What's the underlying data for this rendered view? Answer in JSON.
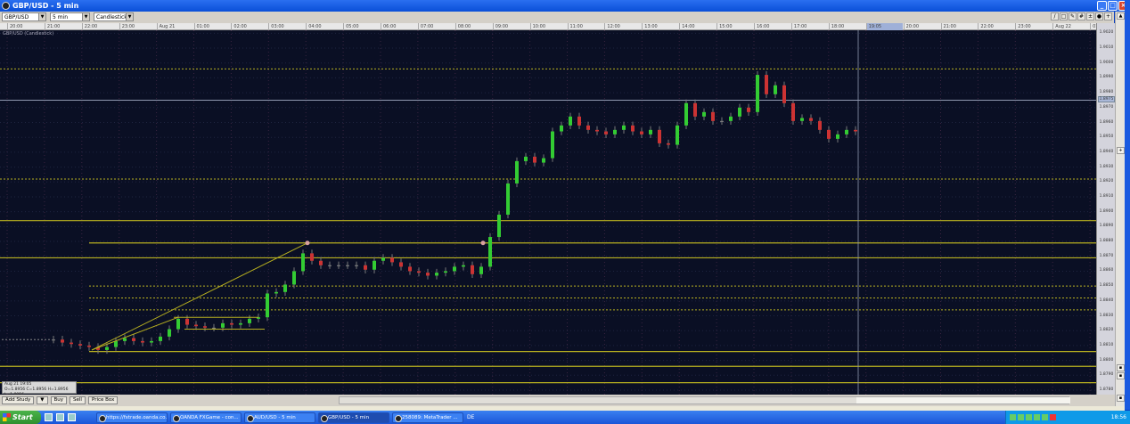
{
  "window": {
    "title": "GBP/USD - 5 min"
  },
  "toolbar": {
    "instrument": "GBP/USD",
    "interval": "5 min",
    "chart_type": "Candlestick"
  },
  "chart_label": "GBP/USD (Candlestick)",
  "time_axis": [
    "20:00",
    "21:00",
    "22:00",
    "23:00",
    "Aug 21",
    "01:00",
    "02:00",
    "03:00",
    "04:00",
    "05:00",
    "06:00",
    "07:00",
    "08:00",
    "09:00",
    "10:00",
    "11:00",
    "12:00",
    "13:00",
    "14:00",
    "15:00",
    "16:00",
    "17:00",
    "18:00",
    "19:05",
    "20:00",
    "21:00",
    "22:00",
    "23:00",
    "Aug 22",
    "01:00"
  ],
  "time_axis_highlight_index": 23,
  "price_axis": [
    "1.9020",
    "1.9010",
    "1.9000",
    "1.8990",
    "1.8980",
    "1.8970",
    "1.8960",
    "1.8950",
    "1.8940",
    "1.8930",
    "1.8920",
    "1.8910",
    "1.8900",
    "1.8890",
    "1.8880",
    "1.8870",
    "1.8860",
    "1.8850",
    "1.8840",
    "1.8830",
    "1.8820",
    "1.8810",
    "1.8800",
    "1.8790",
    "1.8780"
  ],
  "current_price": "1.8975",
  "info_box": {
    "date": "Aug 21 19:05",
    "ohlc": "O=1.8956 C=1.8956 H=1.8956 L=1.8956"
  },
  "bottom_bar": {
    "add_study": "Add Study",
    "buy": "Buy",
    "sell": "Sell",
    "price_box": "Price Box"
  },
  "taskbar": {
    "start": "Start",
    "tasks": [
      "https://fxtrade.oanda.co...",
      "OANDA FXGame - con...",
      "AUD/USD - 5 min",
      "GBP/USD - 5 min",
      "258089: MetaTrader ..."
    ],
    "active_task": 3,
    "lang": "DE",
    "clock": "18:56"
  },
  "colors": {
    "background": "#0a0f24",
    "up": "#33cc33",
    "down": "#cc3333",
    "level": "#b8b020",
    "cursor": "#9098b0"
  },
  "chart_data": {
    "type": "candlestick",
    "ylim": [
      1.8777,
      1.9022
    ],
    "pre_flat_close": 1.8814,
    "closes": [
      1.8814,
      1.8812,
      1.8811,
      1.881,
      1.8809,
      1.8807,
      1.8809,
      1.8813,
      1.8815,
      1.8813,
      1.8812,
      1.8813,
      1.8816,
      1.8821,
      1.8828,
      1.8824,
      1.8823,
      1.8822,
      1.8822,
      1.8825,
      1.8824,
      1.8825,
      1.8828,
      1.8829,
      1.8845,
      1.8846,
      1.8851,
      1.886,
      1.8872,
      1.8867,
      1.8864,
      1.8864,
      1.8864,
      1.8864,
      1.8864,
      1.8861,
      1.8867,
      1.8869,
      1.8866,
      1.8863,
      1.886,
      1.8859,
      1.8857,
      1.8859,
      1.886,
      1.8863,
      1.8864,
      1.8858,
      1.8863,
      1.8883,
      1.8898,
      1.8919,
      1.8934,
      1.8937,
      1.8933,
      1.8936,
      1.8954,
      1.8958,
      1.8964,
      1.8958,
      1.8955,
      1.8954,
      1.8952,
      1.8955,
      1.8958,
      1.8954,
      1.8952,
      1.8955,
      1.8946,
      1.8945,
      1.8958,
      1.8973,
      1.8964,
      1.8967,
      1.8961,
      1.8961,
      1.8964,
      1.897,
      1.8967,
      1.8992,
      1.8979,
      1.8985,
      1.8973,
      1.8961,
      1.8963,
      1.8961,
      1.8955,
      1.8949,
      1.8952,
      1.8955,
      1.8954
    ],
    "levels": [
      {
        "price": 1.8996,
        "style": "dotted"
      },
      {
        "price": 1.8922,
        "style": "dotted"
      },
      {
        "price": 1.8894,
        "style": "solid"
      },
      {
        "price": 1.8879,
        "style": "solid",
        "from": 4
      },
      {
        "price": 1.8869,
        "style": "solid"
      },
      {
        "price": 1.885,
        "style": "dotted",
        "from": 4
      },
      {
        "price": 1.8842,
        "style": "dotted",
        "from": 4
      },
      {
        "price": 1.8834,
        "style": "dotted",
        "from": 4
      },
      {
        "price": 1.8806,
        "style": "solid",
        "from": 4
      },
      {
        "price": 1.8796,
        "style": "solid"
      },
      {
        "price": 1.8785,
        "style": "solid"
      }
    ],
    "trendlines": [
      {
        "from": [
          4.3,
          1.8807
        ],
        "to": [
          28.5,
          1.8879
        ]
      },
      {
        "from": [
          4.3,
          1.8807
        ],
        "to": [
          14,
          1.8829
        ]
      },
      {
        "from": [
          13.5,
          1.8829
        ],
        "to": [
          23,
          1.8829
        ]
      },
      {
        "from": [
          14.7,
          1.8821
        ],
        "to": [
          23.7,
          1.8821
        ]
      }
    ],
    "markers": [
      {
        "index": 28.5,
        "price": 1.8879
      },
      {
        "index": 48.2,
        "price": 1.8879
      }
    ]
  }
}
